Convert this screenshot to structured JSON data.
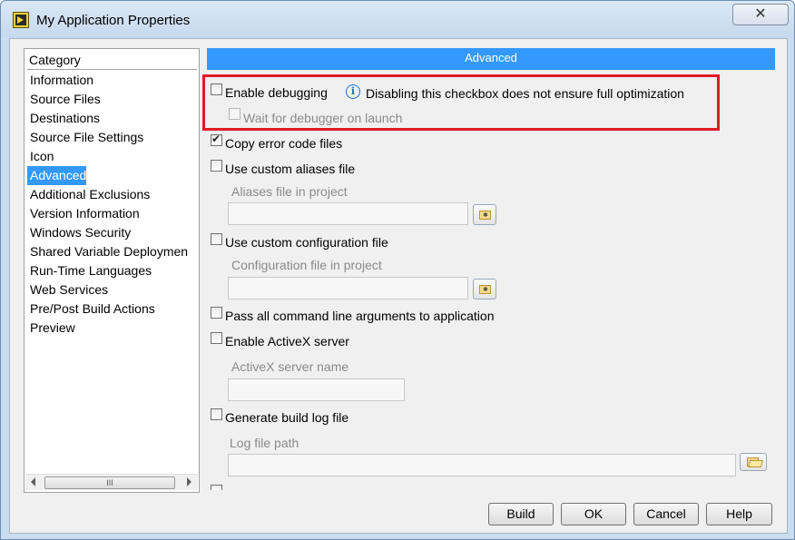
{
  "window": {
    "title": "My Application Properties",
    "close_glyph": "✕"
  },
  "category": {
    "header": "Category",
    "items": [
      {
        "label": "Information"
      },
      {
        "label": "Source Files"
      },
      {
        "label": "Destinations"
      },
      {
        "label": "Source File Settings"
      },
      {
        "label": "Icon"
      },
      {
        "label": "Advanced"
      },
      {
        "label": "Additional Exclusions"
      },
      {
        "label": "Version Information"
      },
      {
        "label": "Windows Security"
      },
      {
        "label": "Shared Variable Deploymen"
      },
      {
        "label": "Run-Time Languages"
      },
      {
        "label": "Web Services"
      },
      {
        "label": "Pre/Post Build Actions"
      },
      {
        "label": "Preview"
      }
    ],
    "selected": "Advanced",
    "scroll_thumb_glyph": "III"
  },
  "advanced": {
    "header": "Advanced",
    "enable_debugging": {
      "label": "Enable debugging",
      "checked": false
    },
    "info_icon_glyph": "i",
    "info_text": "Disabling this checkbox does not ensure full optimization",
    "wait_for_debugger": {
      "label": "Wait for debugger on launch",
      "checked": false,
      "disabled": true
    },
    "copy_error_code": {
      "label": "Copy error code files",
      "checked": true
    },
    "use_custom_aliases": {
      "label": "Use custom aliases file",
      "checked": false
    },
    "aliases_file_label": "Aliases file in project",
    "aliases_file_value": "",
    "use_custom_config": {
      "label": "Use custom configuration file",
      "checked": false
    },
    "config_file_label": "Configuration file in project",
    "config_file_value": "",
    "pass_all_args": {
      "label": "Pass all command line arguments to application",
      "checked": false
    },
    "enable_activex": {
      "label": "Enable ActiveX server",
      "checked": false
    },
    "activex_name_label": "ActiveX server name",
    "activex_name_value": "",
    "generate_build_log": {
      "label": "Generate build log file",
      "checked": false
    },
    "log_file_label": "Log file path",
    "log_file_value": ""
  },
  "buttons": {
    "build": "Build",
    "ok": "OK",
    "cancel": "Cancel",
    "help": "Help"
  },
  "icons": {
    "app": "labview-app-icon",
    "info": "info-icon",
    "browse_project": "project-browse-icon",
    "browse_folder": "folder-open-icon"
  }
}
